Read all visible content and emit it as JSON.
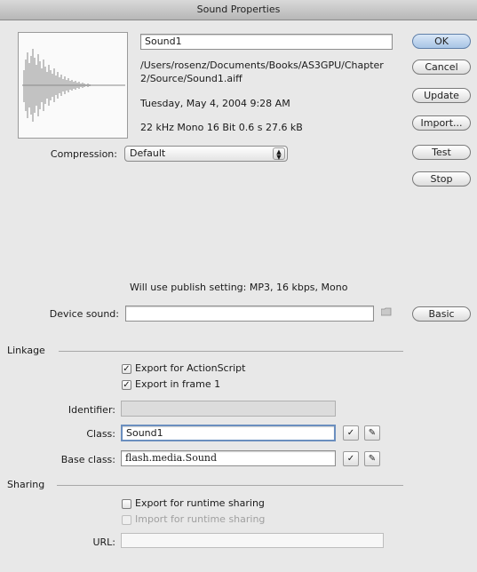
{
  "window": {
    "title": "Sound Properties"
  },
  "info": {
    "name": "Sound1",
    "path": "/Users/rosenz/Documents/Books/AS3GPU/Chapter 2/Source/Sound1.aiff",
    "date": "Tuesday, May 4, 2004  9:28 AM",
    "format": "22 kHz Mono 16 Bit 0.6 s 27.6 kB"
  },
  "buttons": {
    "ok": "OK",
    "cancel": "Cancel",
    "update": "Update",
    "import": "Import...",
    "test": "Test",
    "stop": "Stop",
    "basic": "Basic"
  },
  "compression": {
    "label": "Compression:",
    "value": "Default"
  },
  "publish_note": "Will use publish setting: MP3, 16 kbps, Mono",
  "device": {
    "label": "Device sound:",
    "value": ""
  },
  "linkage": {
    "heading": "Linkage",
    "export_actionscript": {
      "label": "Export for ActionScript",
      "checked": true
    },
    "export_frame1": {
      "label": "Export in frame 1",
      "checked": true
    },
    "identifier_label": "Identifier:",
    "identifier_value": "",
    "class_label": "Class:",
    "class_value": "Sound1",
    "baseclass_label": "Base class:",
    "baseclass_value": "flash.media.Sound"
  },
  "sharing": {
    "heading": "Sharing",
    "export_runtime": {
      "label": "Export for runtime sharing",
      "checked": false
    },
    "import_runtime": {
      "label": "Import for runtime sharing",
      "checked": false
    },
    "url_label": "URL:",
    "url_value": ""
  }
}
